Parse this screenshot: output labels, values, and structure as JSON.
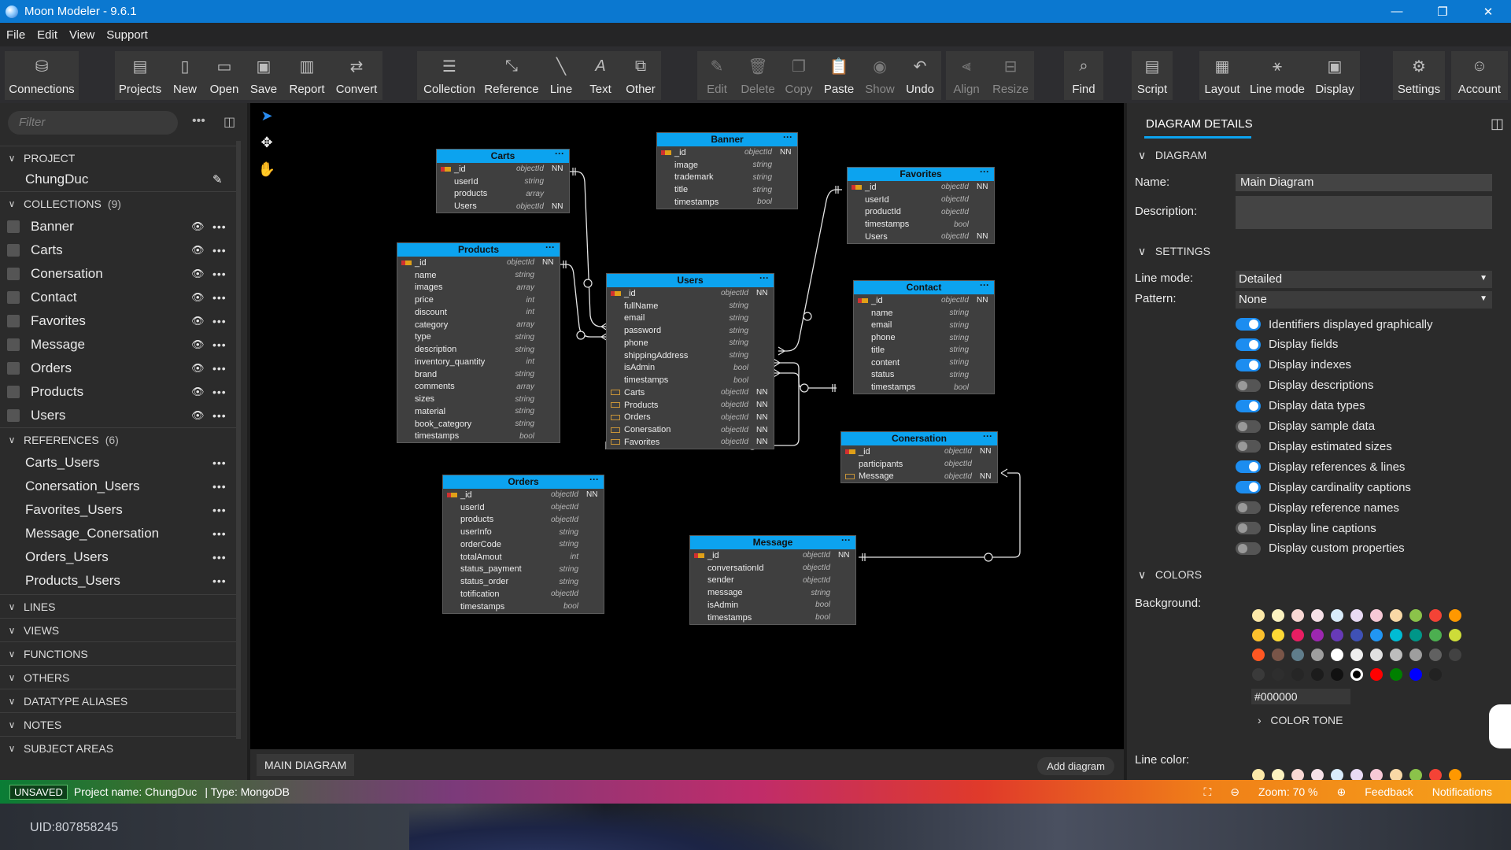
{
  "window": {
    "title": "Moon Modeler - 9.6.1",
    "controls": [
      "—",
      "❐",
      "✕"
    ]
  },
  "menu": [
    "File",
    "Edit",
    "View",
    "Support"
  ],
  "toolbar": [
    {
      "label": "Connections",
      "icon": "database-icon"
    },
    {
      "label": "Projects",
      "icon": "projects-icon"
    },
    {
      "label": "New",
      "icon": "new-file-icon"
    },
    {
      "label": "Open",
      "icon": "folder-icon"
    },
    {
      "label": "Save",
      "icon": "save-icon"
    },
    {
      "label": "Report",
      "icon": "report-icon"
    },
    {
      "label": "Convert",
      "icon": "convert-icon"
    },
    {
      "label": "Collection",
      "icon": "collection-icon"
    },
    {
      "label": "Reference",
      "icon": "reference-icon"
    },
    {
      "label": "Line",
      "icon": "line-icon"
    },
    {
      "label": "Text",
      "icon": "text-icon"
    },
    {
      "label": "Other",
      "icon": "other-icon"
    },
    {
      "label": "Edit",
      "icon": "edit-icon"
    },
    {
      "label": "Delete",
      "icon": "delete-icon"
    },
    {
      "label": "Copy",
      "icon": "copy-icon"
    },
    {
      "label": "Paste",
      "icon": "paste-icon"
    },
    {
      "label": "Show",
      "icon": "eye-icon"
    },
    {
      "label": "Undo",
      "icon": "undo-icon"
    },
    {
      "label": "Align",
      "icon": "align-icon"
    },
    {
      "label": "Resize",
      "icon": "resize-icon"
    },
    {
      "label": "Find",
      "icon": "search-icon"
    },
    {
      "label": "Script",
      "icon": "script-icon"
    },
    {
      "label": "Layout",
      "icon": "layout-icon"
    },
    {
      "label": "Line mode",
      "icon": "line-mode-icon"
    },
    {
      "label": "Display",
      "icon": "display-icon"
    },
    {
      "label": "Settings",
      "icon": "gear-icon"
    },
    {
      "label": "Account",
      "icon": "user-icon"
    }
  ],
  "left": {
    "filter_placeholder": "Filter",
    "project_header": "PROJECT",
    "project_name": "ChungDuc",
    "collections_header": "COLLECTIONS",
    "collections_count": "(9)",
    "collections": [
      "Banner",
      "Carts",
      "Conersation",
      "Contact",
      "Favorites",
      "Message",
      "Orders",
      "Products",
      "Users"
    ],
    "references_header": "REFERENCES",
    "references_count": "(6)",
    "references": [
      "Carts_Users",
      "Conersation_Users",
      "Favorites_Users",
      "Message_Conersation",
      "Orders_Users",
      "Products_Users"
    ],
    "sections": [
      "LINES",
      "VIEWS",
      "FUNCTIONS",
      "OTHERS",
      "DATATYPE ALIASES",
      "NOTES",
      "SUBJECT AREAS"
    ]
  },
  "entities": {
    "carts": {
      "name": "Carts",
      "fields": [
        [
          "pk",
          "_id",
          "objectId",
          "NN"
        ],
        [
          "",
          "userId",
          "string",
          ""
        ],
        [
          "",
          "products",
          "array",
          ""
        ],
        [
          "",
          "Users",
          "objectId",
          "NN"
        ]
      ]
    },
    "banner": {
      "name": "Banner",
      "fields": [
        [
          "pk",
          "_id",
          "objectId",
          "NN"
        ],
        [
          "",
          "image",
          "string",
          ""
        ],
        [
          "",
          "trademark",
          "string",
          ""
        ],
        [
          "",
          "title",
          "string",
          ""
        ],
        [
          "",
          "timestamps",
          "bool",
          ""
        ]
      ]
    },
    "favorites": {
      "name": "Favorites",
      "fields": [
        [
          "pk",
          "_id",
          "objectId",
          "NN"
        ],
        [
          "",
          "userId",
          "objectId",
          ""
        ],
        [
          "",
          "productId",
          "objectId",
          ""
        ],
        [
          "",
          "timestamps",
          "bool",
          ""
        ],
        [
          "",
          "Users",
          "objectId",
          "NN"
        ]
      ]
    },
    "products": {
      "name": "Products",
      "fields": [
        [
          "pk",
          "_id",
          "objectId",
          "NN"
        ],
        [
          "",
          "name",
          "string",
          ""
        ],
        [
          "",
          "images",
          "array",
          ""
        ],
        [
          "",
          "price",
          "int",
          ""
        ],
        [
          "",
          "discount",
          "int",
          ""
        ],
        [
          "",
          "category",
          "array",
          ""
        ],
        [
          "",
          "type",
          "string",
          ""
        ],
        [
          "",
          "description",
          "string",
          ""
        ],
        [
          "",
          "inventory_quantity",
          "int",
          ""
        ],
        [
          "",
          "brand",
          "string",
          ""
        ],
        [
          "",
          "comments",
          "array",
          ""
        ],
        [
          "",
          "sizes",
          "string",
          ""
        ],
        [
          "",
          "material",
          "string",
          ""
        ],
        [
          "",
          "book_category",
          "string",
          ""
        ],
        [
          "",
          "timestamps",
          "bool",
          ""
        ]
      ]
    },
    "users": {
      "name": "Users",
      "fields": [
        [
          "pk",
          "_id",
          "objectId",
          "NN"
        ],
        [
          "",
          "fullName",
          "string",
          ""
        ],
        [
          "",
          "email",
          "string",
          ""
        ],
        [
          "",
          "password",
          "string",
          ""
        ],
        [
          "",
          "phone",
          "string",
          ""
        ],
        [
          "",
          "shippingAddress",
          "string",
          ""
        ],
        [
          "",
          "isAdmin",
          "bool",
          ""
        ],
        [
          "",
          "timestamps",
          "bool",
          ""
        ],
        [
          "fk",
          "Carts",
          "objectId",
          "NN"
        ],
        [
          "fk",
          "Products",
          "objectId",
          "NN"
        ],
        [
          "fk",
          "Orders",
          "objectId",
          "NN"
        ],
        [
          "fk",
          "Conersation",
          "objectId",
          "NN"
        ],
        [
          "fk",
          "Favorites",
          "objectId",
          "NN"
        ]
      ]
    },
    "contact": {
      "name": "Contact",
      "fields": [
        [
          "pk",
          "_id",
          "objectId",
          "NN"
        ],
        [
          "",
          "name",
          "string",
          ""
        ],
        [
          "",
          "email",
          "string",
          ""
        ],
        [
          "",
          "phone",
          "string",
          ""
        ],
        [
          "",
          "title",
          "string",
          ""
        ],
        [
          "",
          "content",
          "string",
          ""
        ],
        [
          "",
          "status",
          "string",
          ""
        ],
        [
          "",
          "timestamps",
          "bool",
          ""
        ]
      ]
    },
    "conersation": {
      "name": "Conersation",
      "fields": [
        [
          "pk",
          "_id",
          "objectId",
          "NN"
        ],
        [
          "",
          "participants",
          "objectId",
          ""
        ],
        [
          "fk",
          "Message",
          "objectId",
          "NN"
        ]
      ]
    },
    "orders": {
      "name": "Orders",
      "fields": [
        [
          "pk",
          "_id",
          "objectId",
          "NN"
        ],
        [
          "",
          "userId",
          "objectId",
          ""
        ],
        [
          "",
          "products",
          "objectId",
          ""
        ],
        [
          "",
          "userInfo",
          "string",
          ""
        ],
        [
          "",
          "orderCode",
          "string",
          ""
        ],
        [
          "",
          "totalAmout",
          "int",
          ""
        ],
        [
          "",
          "status_payment",
          "string",
          ""
        ],
        [
          "",
          "status_order",
          "string",
          ""
        ],
        [
          "",
          "totification",
          "objectId",
          ""
        ],
        [
          "",
          "timestamps",
          "bool",
          ""
        ]
      ]
    },
    "message": {
      "name": "Message",
      "fields": [
        [
          "pk",
          "_id",
          "objectId",
          "NN"
        ],
        [
          "",
          "conversationId",
          "objectId",
          ""
        ],
        [
          "",
          "sender",
          "objectId",
          ""
        ],
        [
          "",
          "message",
          "string",
          ""
        ],
        [
          "",
          "isAdmin",
          "bool",
          ""
        ],
        [
          "",
          "timestamps",
          "bool",
          ""
        ]
      ]
    }
  },
  "canvas": {
    "tab": "MAIN DIAGRAM",
    "add_diagram": "Add diagram"
  },
  "right": {
    "title": "DIAGRAM DETAILS",
    "diagram_section": "DIAGRAM",
    "name_label": "Name:",
    "name_value": "Main Diagram",
    "description_label": "Description:",
    "settings_section": "SETTINGS",
    "line_mode_label": "Line mode:",
    "line_mode_value": "Detailed",
    "pattern_label": "Pattern:",
    "pattern_value": "None",
    "toggles": [
      {
        "label": "Identifiers displayed graphically",
        "on": true
      },
      {
        "label": "Display fields",
        "on": true
      },
      {
        "label": "Display indexes",
        "on": true
      },
      {
        "label": "Display descriptions",
        "on": false
      },
      {
        "label": "Display data types",
        "on": true
      },
      {
        "label": "Display sample data",
        "on": false
      },
      {
        "label": "Display estimated sizes",
        "on": false
      },
      {
        "label": "Display references & lines",
        "on": true
      },
      {
        "label": "Display cardinality captions",
        "on": true
      },
      {
        "label": "Display reference names",
        "on": false
      },
      {
        "label": "Display line captions",
        "on": false
      },
      {
        "label": "Display custom properties",
        "on": false
      }
    ],
    "colors_section": "COLORS",
    "background_label": "Background:",
    "background_hex": "#000000",
    "color_tone": "COLOR TONE",
    "line_color_label": "Line color:"
  },
  "status": {
    "unsaved": "UNSAVED",
    "project": "Project name: ChungDuc",
    "type": "| Type: MongoDB",
    "zoom": "Zoom: 70 %",
    "feedback": "Feedback",
    "notifications": "Notifications"
  },
  "taskbar": {
    "uid": "UID:807858245"
  },
  "colors": {
    "accent": "#0ca3ef",
    "titlebar": "#0b78d0"
  }
}
